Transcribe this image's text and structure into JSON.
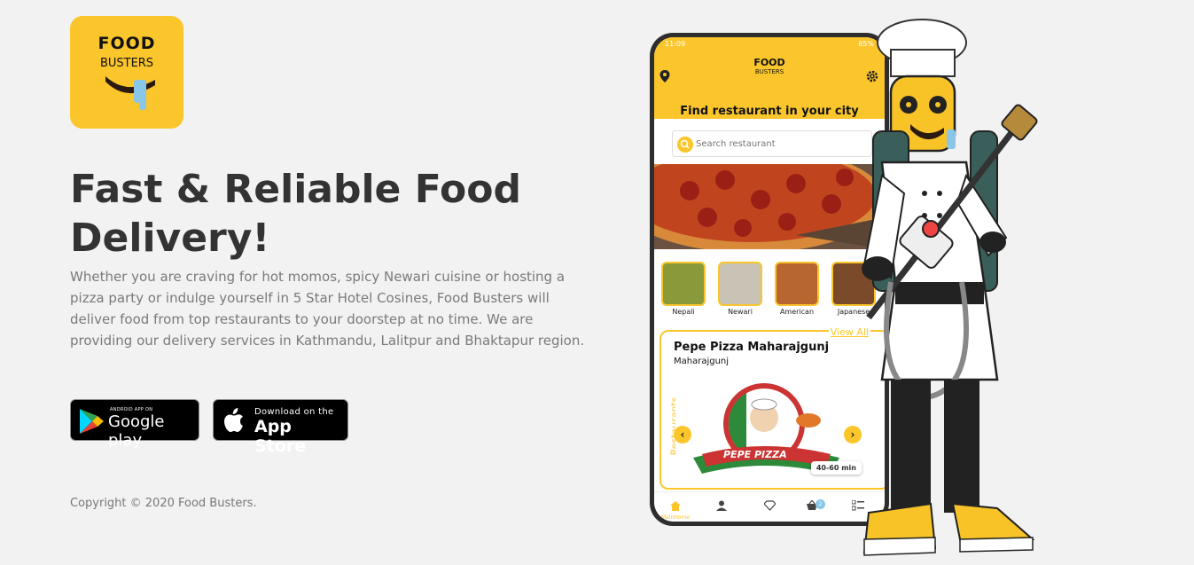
{
  "logo": {
    "word1": "FOOD",
    "word2": "BUSTERS"
  },
  "hero": {
    "headline": "Fast & Reliable Food Delivery!",
    "description": "Whether you are craving for hot momos, spicy Newari cuisine or hosting a pizza party or indulge yourself in 5 Star Hotel Cosines, Food Busters will deliver food from top restaurants to your doorstep at no time. We are providing our delivery services in Kathmandu, Lalitpur and Bhaktapur region."
  },
  "stores": {
    "google_small": "ANDROID APP ON",
    "google_big": "Google play",
    "apple_small": "Download on the",
    "apple_big": "App Store"
  },
  "footer": {
    "copyright": "Copyright © 2020 Food Busters."
  },
  "phone": {
    "status_time": "11:09",
    "status_battery": "85%",
    "logo1": "FOOD",
    "logo2": "BUSTERS",
    "find_title": "Find restaurant in your city",
    "search_placeholder": "Search restaurant",
    "categories": [
      "Nepali",
      "Newari",
      "American",
      "Japanese"
    ],
    "view_all": "View All",
    "restaurants_label": "Restaurants",
    "restaurant_name": "Pepe Pizza Maharajgunj",
    "restaurant_area": "Maharajgunj",
    "restaurant_logo_text": "PEPE PIZZA",
    "delivery_time": "40-60 min",
    "tab_home": "MainHome",
    "cart_count": "2"
  },
  "colors": {
    "brand_yellow": "#fbc62b",
    "background": "#f2f2f2",
    "heading": "#333333",
    "body_text": "#7a7a7a"
  }
}
